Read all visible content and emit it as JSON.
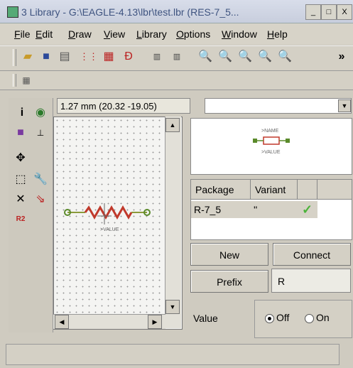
{
  "window": {
    "title": "3 Library - G:\\EAGLE-4.13\\lbr\\test.lbr (RES-7_5...",
    "buttons": {
      "minimize": "_",
      "maximize": "□",
      "close": "X"
    }
  },
  "menu": {
    "items": [
      "File",
      "Edit",
      "Draw",
      "View",
      "Library",
      "Options",
      "Window",
      "Help"
    ],
    "mnemonics": [
      "F",
      "E",
      "D",
      "V",
      "L",
      "O",
      "W",
      "H"
    ]
  },
  "toolbar": {
    "icons": [
      "open-icon",
      "save-icon",
      "print-icon",
      "pinout-icon",
      "package-icon",
      "symbol-icon",
      "script-icon",
      "script2-icon",
      "zoom-fit-icon",
      "zoom-in-icon",
      "zoom-out-icon",
      "zoom-redraw-icon",
      "zoom-select-icon"
    ],
    "overflow": "»"
  },
  "coords": {
    "text": "1.27 mm (20.32 -19.05)"
  },
  "preview": {
    "name_label": ">NAME",
    "value_label": ">VALUE"
  },
  "canvas": {
    "part_label": ">VALUE"
  },
  "package_table": {
    "headers": [
      "Package",
      "Variant"
    ],
    "rows": [
      {
        "package": "R-7_5",
        "variant": "''",
        "ok": "✓"
      }
    ]
  },
  "buttons": {
    "new": "New",
    "connect": "Connect",
    "prefix": "Prefix"
  },
  "prefix": {
    "value": "R"
  },
  "value": {
    "label": "Value",
    "off": "Off",
    "on": "On",
    "selected": "Off"
  },
  "colors": {
    "title_text": "#3f5480",
    "resistor": "#c0392b",
    "pin": "#5a8a2a",
    "check": "#4bb33a"
  }
}
